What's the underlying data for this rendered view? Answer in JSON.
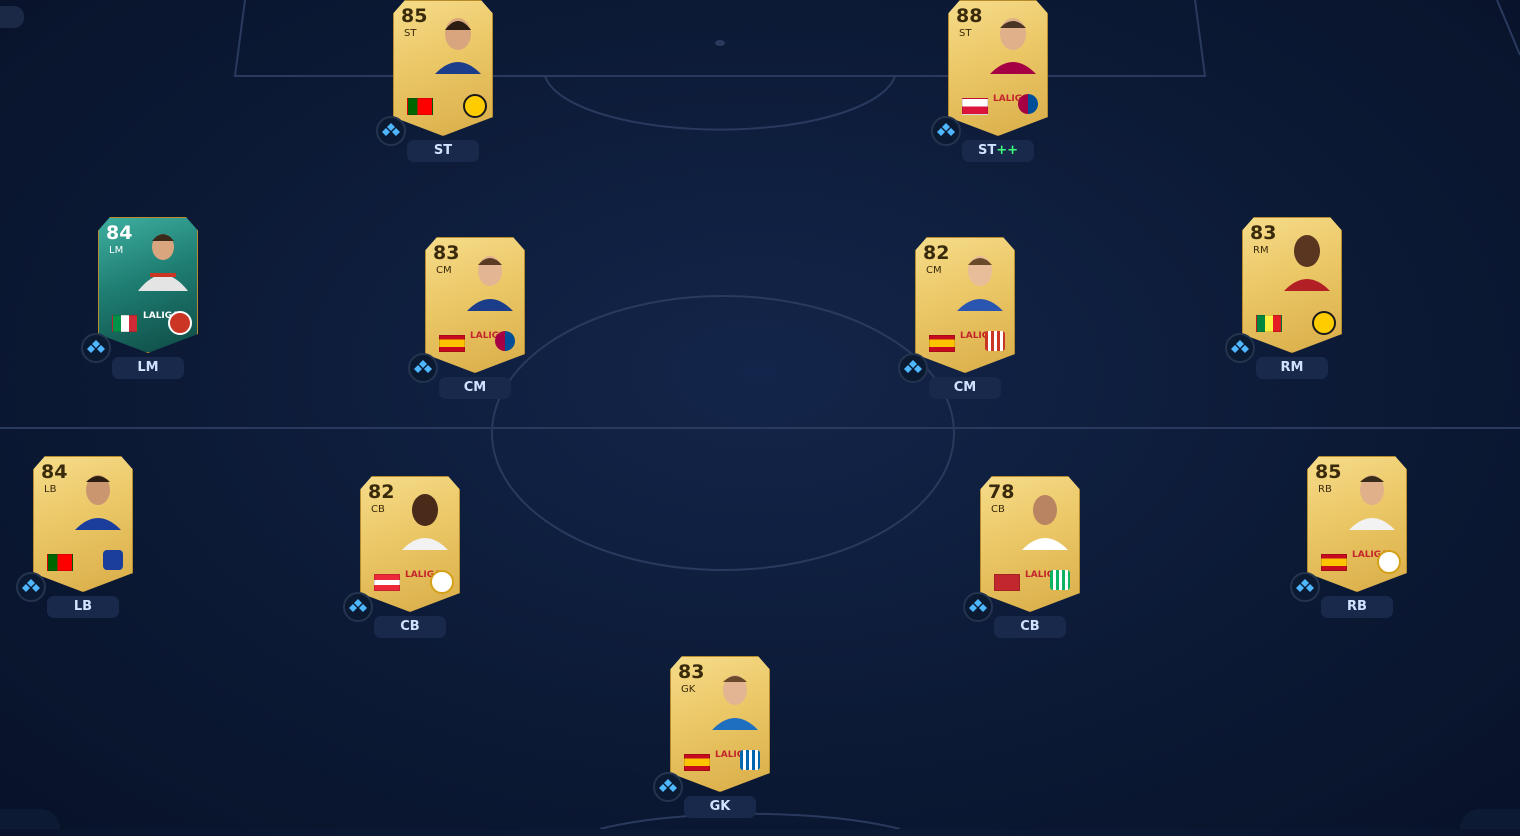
{
  "players": [
    {
      "rating": "85",
      "position": "ST",
      "label": "ST",
      "label_extra": "",
      "flag_colors": [
        "#006600",
        "#ff0000"
      ],
      "league_text": "",
      "club_color": "#ffcc00",
      "card": "gold"
    },
    {
      "rating": "88",
      "position": "ST",
      "label": "ST",
      "label_extra": "++",
      "flag_colors": [
        "#ffffff",
        "#dc143c"
      ],
      "league_text": "LALIGA",
      "club_color": "#a50044",
      "card": "gold"
    },
    {
      "rating": "84",
      "position": "LM",
      "label": "LM",
      "label_extra": "",
      "flag_colors": [
        "#009246",
        "#ffffff",
        "#ce2b37"
      ],
      "league_text": "LALIGA",
      "club_color": "#cb3524",
      "card": "special"
    },
    {
      "rating": "83",
      "position": "CM",
      "label": "CM",
      "label_extra": "",
      "flag_colors": [
        "#c60b1e",
        "#ffc400",
        "#c60b1e"
      ],
      "league_text": "LALIGA",
      "club_color": "#a50044",
      "card": "gold"
    },
    {
      "rating": "82",
      "position": "CM",
      "label": "CM",
      "label_extra": "",
      "flag_colors": [
        "#c60b1e",
        "#ffc400",
        "#c60b1e"
      ],
      "league_text": "LALIGA",
      "club_color": "#cb3524",
      "card": "gold"
    },
    {
      "rating": "83",
      "position": "RM",
      "label": "RM",
      "label_extra": "",
      "flag_colors": [
        "#00853f",
        "#fdef42",
        "#e31b23"
      ],
      "league_text": "",
      "club_color": "#ffcc00",
      "card": "gold"
    },
    {
      "rating": "84",
      "position": "LB",
      "label": "LB",
      "label_extra": "",
      "flag_colors": [
        "#006600",
        "#ff0000"
      ],
      "league_text": "",
      "club_color": "#1b3d9c",
      "card": "gold"
    },
    {
      "rating": "82",
      "position": "CB",
      "label": "CB",
      "label_extra": "",
      "flag_colors": [
        "#ed2939",
        "#ffffff",
        "#ed2939"
      ],
      "league_text": "LALIGA",
      "club_color": "#e8e8e8",
      "card": "gold"
    },
    {
      "rating": "78",
      "position": "CB",
      "label": "CB",
      "label_extra": "",
      "flag_colors": [
        "#c1272d",
        "#c1272d"
      ],
      "league_text": "LALIGA",
      "club_color": "#0bb363",
      "card": "gold"
    },
    {
      "rating": "85",
      "position": "RB",
      "label": "RB",
      "label_extra": "",
      "flag_colors": [
        "#c60b1e",
        "#ffc400",
        "#c60b1e"
      ],
      "league_text": "LALIGA",
      "club_color": "#e8e8e8",
      "card": "gold"
    },
    {
      "rating": "83",
      "position": "GK",
      "label": "GK",
      "label_extra": "",
      "flag_colors": [
        "#c60b1e",
        "#ffc400",
        "#c60b1e"
      ],
      "league_text": "LALIGA",
      "club_color": "#0067b1",
      "card": "gold"
    }
  ]
}
